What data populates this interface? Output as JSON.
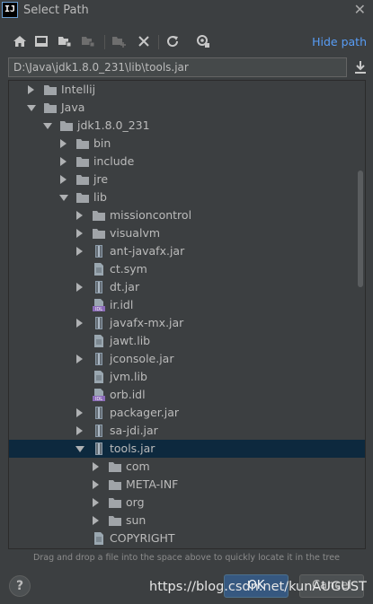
{
  "window": {
    "title": "Select Path",
    "app_icon": "IJ"
  },
  "toolbar": {
    "hide_path_label": "Hide path"
  },
  "path_field": {
    "value": "D:\\Java\\jdk1.8.0_231\\lib\\tools.jar"
  },
  "tree": {
    "rows": [
      {
        "label": "Intellij",
        "type": "folder",
        "expand": "right",
        "level": 1
      },
      {
        "label": "Java",
        "type": "folder",
        "expand": "down",
        "level": 1
      },
      {
        "label": "jdk1.8.0_231",
        "type": "folder",
        "expand": "down",
        "level": 2
      },
      {
        "label": "bin",
        "type": "folder",
        "expand": "right",
        "level": 3
      },
      {
        "label": "include",
        "type": "folder",
        "expand": "right",
        "level": 3
      },
      {
        "label": "jre",
        "type": "folder",
        "expand": "right",
        "level": 3
      },
      {
        "label": "lib",
        "type": "folder",
        "expand": "down",
        "level": 3
      },
      {
        "label": "missioncontrol",
        "type": "folder",
        "expand": "right",
        "level": 4
      },
      {
        "label": "visualvm",
        "type": "folder",
        "expand": "right",
        "level": 4
      },
      {
        "label": "ant-javafx.jar",
        "type": "jar",
        "expand": "right",
        "level": 4
      },
      {
        "label": "ct.sym",
        "type": "file",
        "expand": "none",
        "level": 4
      },
      {
        "label": "dt.jar",
        "type": "jar",
        "expand": "right",
        "level": 4
      },
      {
        "label": "ir.idl",
        "type": "idl",
        "expand": "none",
        "level": 4
      },
      {
        "label": "javafx-mx.jar",
        "type": "jar",
        "expand": "right",
        "level": 4
      },
      {
        "label": "jawt.lib",
        "type": "lib",
        "expand": "none",
        "level": 4
      },
      {
        "label": "jconsole.jar",
        "type": "jar",
        "expand": "right",
        "level": 4
      },
      {
        "label": "jvm.lib",
        "type": "lib",
        "expand": "none",
        "level": 4
      },
      {
        "label": "orb.idl",
        "type": "idl",
        "expand": "none",
        "level": 4
      },
      {
        "label": "packager.jar",
        "type": "jar",
        "expand": "right",
        "level": 4
      },
      {
        "label": "sa-jdi.jar",
        "type": "jar",
        "expand": "right",
        "level": 4
      },
      {
        "label": "tools.jar",
        "type": "jar",
        "expand": "down",
        "level": 4,
        "selected": true
      },
      {
        "label": "com",
        "type": "folder",
        "expand": "right",
        "level": 5
      },
      {
        "label": "META-INF",
        "type": "folder",
        "expand": "right",
        "level": 5
      },
      {
        "label": "org",
        "type": "folder",
        "expand": "right",
        "level": 5
      },
      {
        "label": "sun",
        "type": "folder",
        "expand": "right",
        "level": 5
      },
      {
        "label": "COPYRIGHT",
        "type": "file",
        "expand": "none",
        "level": 4
      }
    ]
  },
  "footer": {
    "hint": "Drag and drop a file into the space above to quickly locate it in the tree",
    "help_label": "?",
    "ok_label": "OK",
    "cancel_label": "Cancel"
  },
  "watermark": "https://blog.csdn.net/kunAUGUST",
  "colors": {
    "accent": "#589df6",
    "selection": "#0d293e",
    "background": "#3c3f41"
  }
}
